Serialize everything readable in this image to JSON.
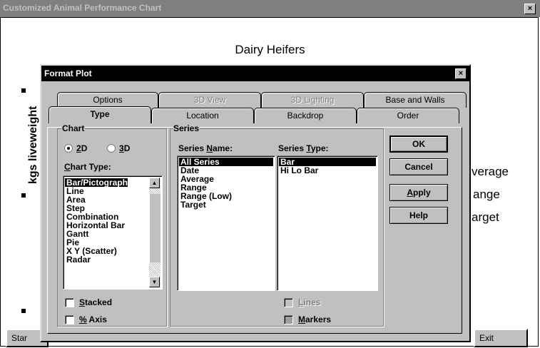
{
  "window": {
    "title": "Customized Animal Performance Chart",
    "close_label": "×"
  },
  "chart": {
    "title": "Dairy Heifers",
    "ylabel": "kgs liveweight",
    "legend": [
      "Average",
      "Range",
      "Target"
    ],
    "legend_visible": [
      "verage",
      "ange",
      "arget"
    ]
  },
  "background_buttons": {
    "start": "Star",
    "exit": "Exit"
  },
  "dialog": {
    "title": "Format Plot",
    "close_label": "×",
    "tabs_back": [
      "Options",
      "3D View",
      "3D Lighting",
      "Base and Walls"
    ],
    "tabs_front": [
      "Type",
      "Location",
      "Backdrop",
      "Order"
    ],
    "active_tab": "Type",
    "chart_group": {
      "legend": "Chart",
      "radio_2d": "2D",
      "radio_3d": "3D",
      "selected": "2D",
      "chart_type_label": "Chart Type:",
      "chart_types": [
        "Bar/Pictograph",
        "Line",
        "Area",
        "Step",
        "Combination",
        "Horizontal Bar",
        "Gantt",
        "Pie",
        "X Y (Scatter)",
        "Radar"
      ],
      "selected_type": "Bar/Pictograph",
      "stacked": "Stacked",
      "percent_axis": "% Axis"
    },
    "series_group": {
      "legend": "Series",
      "name_label": "Series Name:",
      "names": [
        "All Series",
        "Date",
        "Average",
        "Range",
        "Range (Low)",
        "Target"
      ],
      "selected_name": "All Series",
      "type_label": "Series Type:",
      "types": [
        "Bar",
        "Hi Lo Bar"
      ],
      "selected_type": "Bar",
      "lines": "Lines",
      "markers": "Markers"
    },
    "buttons": {
      "ok": "OK",
      "cancel": "Cancel",
      "apply": "Apply",
      "help": "Help"
    }
  }
}
